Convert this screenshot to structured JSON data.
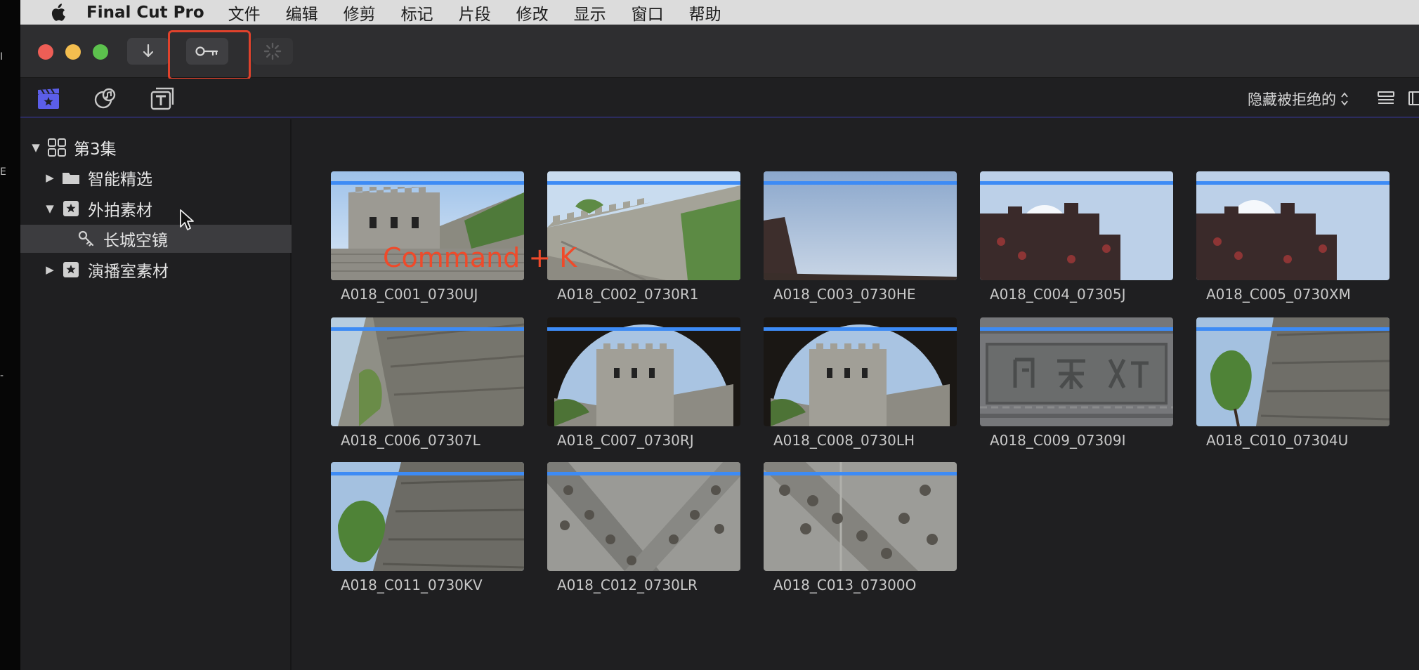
{
  "menubar": {
    "app_name": "Final Cut Pro",
    "items": [
      "文件",
      "编辑",
      "修剪",
      "标记",
      "片段",
      "修改",
      "显示",
      "窗口",
      "帮助"
    ]
  },
  "edge_glyphs": [
    "I",
    "E",
    "-"
  ],
  "toolbar": {
    "import_icon": "download-arrow-icon",
    "keyword_icon": "key-icon",
    "bg_task_icon": "spinner-icon"
  },
  "library_bar": {
    "filter_label": "隐藏被拒绝的",
    "tabs": [
      "clapper-icon",
      "music-photo-icon",
      "titles-icon"
    ]
  },
  "sidebar": {
    "items": [
      {
        "label": "第3集",
        "level": 0,
        "disclosure": "▼",
        "icon": "library-grid-icon"
      },
      {
        "label": "智能精选",
        "level": 1,
        "disclosure": "▶",
        "icon": "folder-icon"
      },
      {
        "label": "外拍素材",
        "level": 1,
        "disclosure": "▼",
        "icon": "event-star-icon"
      },
      {
        "label": "长城空镜",
        "level": 2,
        "disclosure": "",
        "icon": "keyword-collection-icon"
      },
      {
        "label": "演播室素材",
        "level": 1,
        "disclosure": "▶",
        "icon": "event-star-icon"
      }
    ]
  },
  "clips": [
    {
      "name": "A018_C001_0730UJ",
      "scene": "tower"
    },
    {
      "name": "A018_C002_0730R1",
      "scene": "wall"
    },
    {
      "name": "A018_C003_0730HE",
      "scene": "sky"
    },
    {
      "name": "A018_C004_07305J",
      "scene": "sun"
    },
    {
      "name": "A018_C005_0730XM",
      "scene": "sun"
    },
    {
      "name": "A018_C006_07307L",
      "scene": "stonewall"
    },
    {
      "name": "A018_C007_0730RJ",
      "scene": "arch"
    },
    {
      "name": "A018_C008_0730LH",
      "scene": "arch"
    },
    {
      "name": "A018_C009_07309I",
      "scene": "plaque"
    },
    {
      "name": "A018_C010_07304U",
      "scene": "tree"
    },
    {
      "name": "A018_C011_0730KV",
      "scene": "tree"
    },
    {
      "name": "A018_C012_0730LR",
      "scene": "door"
    },
    {
      "name": "A018_C013_07300O",
      "scene": "door"
    }
  ],
  "overlay": {
    "shortcut_text": "Command + K"
  },
  "colors": {
    "accent_blue": "#3d8bf5",
    "highlight_red": "#e0422c"
  }
}
